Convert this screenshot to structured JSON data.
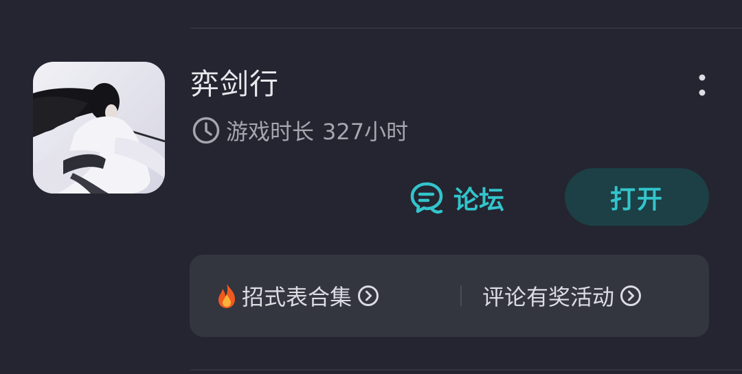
{
  "game": {
    "title": "弈剑行",
    "playtime_label": "游戏时长",
    "playtime_value": "327小时"
  },
  "actions": {
    "forum_label": "论坛",
    "open_label": "打开"
  },
  "quick_links": [
    {
      "label": "招式表合集",
      "icon": "fire-icon"
    },
    {
      "label": "评论有奖活动",
      "icon": null
    }
  ],
  "colors": {
    "background": "#242530",
    "accent": "#33c4cc",
    "open_button_bg": "#1c4045",
    "panel_bg": "#33353f",
    "primary_text": "#e8e8ec",
    "secondary_text": "#a5a6ae"
  }
}
